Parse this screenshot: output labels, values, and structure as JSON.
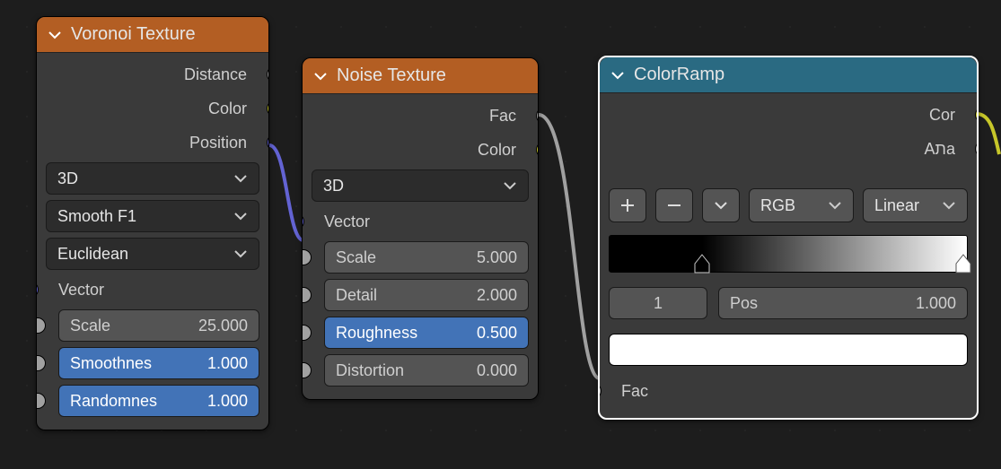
{
  "voronoi": {
    "title": "Voronoi Texture",
    "outputs": {
      "distance": {
        "label": "Distance",
        "type": "gray"
      },
      "color": {
        "label": "Color",
        "type": "yellow"
      },
      "position": {
        "label": "Position",
        "type": "purple"
      }
    },
    "dropdowns": {
      "dimensions": "3D",
      "feature": "Smooth F1",
      "metric": "Euclidean"
    },
    "vector_label": "Vector",
    "params": [
      {
        "key": "scale",
        "label": "Scale",
        "value": "25.000",
        "blue": false
      },
      {
        "key": "smoothness",
        "label": "Smoothnes",
        "value": "1.000",
        "blue": true
      },
      {
        "key": "randomness",
        "label": "Randomnes",
        "value": "1.000",
        "blue": true
      }
    ]
  },
  "noise": {
    "title": "Noise Texture",
    "outputs": {
      "fac": {
        "label": "Fac",
        "type": "gray"
      },
      "color": {
        "label": "Color",
        "type": "yellow"
      }
    },
    "dropdowns": {
      "dimensions": "3D"
    },
    "vector_label": "Vector",
    "params": [
      {
        "key": "scale",
        "label": "Scale",
        "value": "5.000",
        "blue": false
      },
      {
        "key": "detail",
        "label": "Detail",
        "value": "2.000",
        "blue": false
      },
      {
        "key": "roughness",
        "label": "Roughness",
        "value": "0.500",
        "blue": true
      },
      {
        "key": "distortion",
        "label": "Distortion",
        "value": "0.000",
        "blue": false
      }
    ]
  },
  "ramp": {
    "title": "ColorRamp",
    "outputs": {
      "color": {
        "label": "Cor",
        "type": "yellow"
      },
      "alpha": {
        "label": "Aתa",
        "type": "gray"
      }
    },
    "mode_rgb": "RGB",
    "mode_interp": "Linear",
    "stop_index": "1",
    "pos_label": "Pos",
    "pos_value": "1.000",
    "fac_label": "Fac",
    "gradient": {
      "stops": [
        {
          "pos": 0.26,
          "color": "#000000"
        },
        {
          "pos": 1.0,
          "color": "#ffffff"
        }
      ]
    },
    "swatch_color": "#ffffff"
  },
  "colors": {
    "orange": "#b35e23",
    "teal": "#2a6a82",
    "blue_field": "#4273b7"
  }
}
